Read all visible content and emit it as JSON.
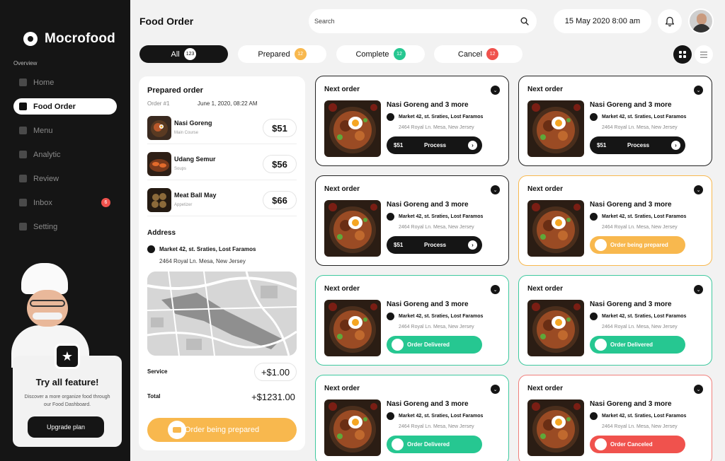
{
  "app": {
    "name": "Mocrofood"
  },
  "colors": {
    "accent": "#151515",
    "prepared": "#f8b84e",
    "delivered": "#26c791",
    "canceled": "#f0524d"
  },
  "sidebar": {
    "section_label": "Overview",
    "items": [
      {
        "label": "Home",
        "icon": "home-icon"
      },
      {
        "label": "Food Order",
        "icon": "order-icon",
        "active": true
      },
      {
        "label": "Menu",
        "icon": "menu-icon"
      },
      {
        "label": "Analytic",
        "icon": "chart-icon"
      },
      {
        "label": "Review",
        "icon": "review-icon"
      },
      {
        "label": "Inbox",
        "icon": "inbox-icon",
        "badge": "6"
      },
      {
        "label": "Setting",
        "icon": "gear-icon"
      }
    ],
    "promo": {
      "title": "Try all feature!",
      "description": "Discover a more organize food through our Food Dashboard.",
      "button": "Upgrade plan"
    }
  },
  "header": {
    "title": "Food Order",
    "search_placeholder": "Search",
    "date": "15 May 2020 8:00 am"
  },
  "tabs": [
    {
      "label": "All",
      "count": "123",
      "active": true,
      "color": "#ffffff"
    },
    {
      "label": "Prepared",
      "count": "12",
      "color": "#f8b84e"
    },
    {
      "label": "Complete",
      "count": "12",
      "color": "#26c791"
    },
    {
      "label": "Cancel",
      "count": "12",
      "color": "#f0524d"
    }
  ],
  "prepared_order": {
    "title": "Prepared order",
    "order_number": "Order #1",
    "date": "June 1, 2020, 08:22 AM",
    "items": [
      {
        "name": "Nasi Goreng",
        "category": "Main Course",
        "price": "$51"
      },
      {
        "name": "Udang Semur",
        "category": "Soups",
        "price": "$56"
      },
      {
        "name": "Meat Ball May",
        "category": "Appetizer",
        "price": "$66"
      }
    ],
    "address_title": "Address",
    "address_line1": "Market 42, st. Sraties, Lost Faramos",
    "address_line2": "2464 Royal Ln. Mesa, New Jersey",
    "service_label": "Service",
    "service_value": "+$1.00",
    "total_label": "Total",
    "total_value": "+$1231.00",
    "status": "Order being prepared"
  },
  "cards": [
    {
      "title": "Next order",
      "name": "Nasi Goreng and 3 more",
      "addr1": "Market 42, st. Sraties, Lost Faramos",
      "addr2": "2464 Royal Ln. Mesa, New Jersey",
      "state": "process",
      "price": "$51",
      "button": "Process"
    },
    {
      "title": "Next order",
      "name": "Nasi Goreng and 3 more",
      "addr1": "Market 42, st. Sraties, Lost Faramos",
      "addr2": "2464 Royal Ln. Mesa, New Jersey",
      "state": "process",
      "price": "$51",
      "button": "Process"
    },
    {
      "title": "Next order",
      "name": "Nasi Goreng and 3 more",
      "addr1": "Market 42, st. Sraties, Lost Faramos",
      "addr2": "2464 Royal Ln. Mesa, New Jersey",
      "state": "process",
      "price": "$51",
      "button": "Process"
    },
    {
      "title": "Next order",
      "name": "Nasi Goreng and 3 more",
      "addr1": "Market 42, st. Sraties, Lost Faramos",
      "addr2": "2464 Royal Ln. Mesa, New Jersey",
      "state": "prepared",
      "button": "Order being prepared"
    },
    {
      "title": "Next order",
      "name": "Nasi Goreng and 3 more",
      "addr1": "Market 42, st. Sraties, Lost Faramos",
      "addr2": "2464 Royal Ln. Mesa, New Jersey",
      "state": "delivered",
      "button": "Order Delivered"
    },
    {
      "title": "Next order",
      "name": "Nasi Goreng and 3 more",
      "addr1": "Market 42, st. Sraties, Lost Faramos",
      "addr2": "2464 Royal Ln. Mesa, New Jersey",
      "state": "delivered",
      "button": "Order Delivered"
    },
    {
      "title": "Next order",
      "name": "Nasi Goreng and 3 more",
      "addr1": "Market 42, st. Sraties, Lost Faramos",
      "addr2": "2464 Royal Ln. Mesa, New Jersey",
      "state": "delivered",
      "button": "Order Delivered"
    },
    {
      "title": "Next order",
      "name": "Nasi Goreng and 3 more",
      "addr1": "Market 42, st. Sraties, Lost Faramos",
      "addr2": "2464 Royal Ln. Mesa, New Jersey",
      "state": "canceled",
      "button": "Order Canceled"
    }
  ]
}
